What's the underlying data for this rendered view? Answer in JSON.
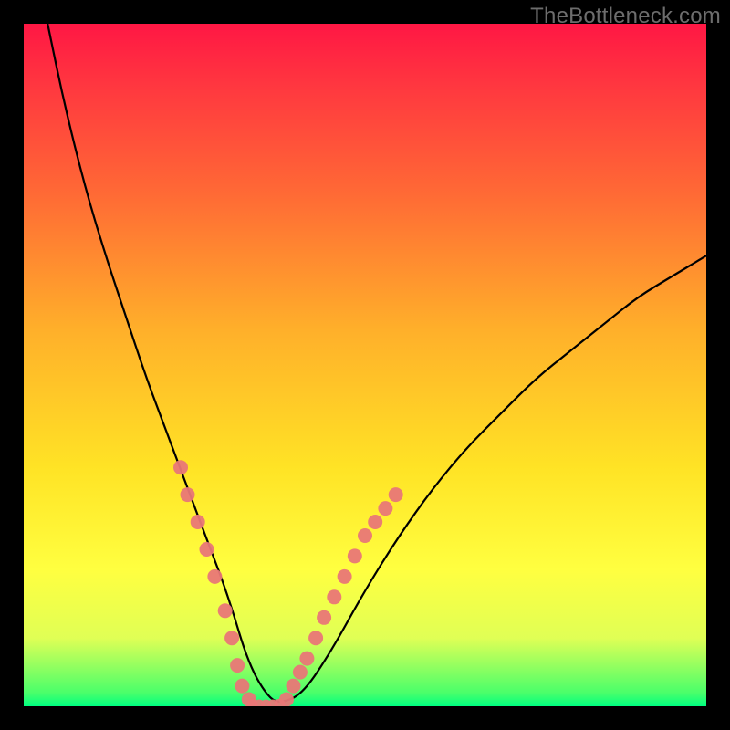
{
  "watermark": "TheBottleneck.com",
  "colors": {
    "background": "#000000",
    "gradient_top": "#ff1744",
    "gradient_bottom": "#00ff80",
    "curve": "#000000",
    "markers": "#e97777"
  },
  "chart_data": {
    "type": "line",
    "title": "",
    "xlabel": "",
    "ylabel": "",
    "xlim": [
      0,
      100
    ],
    "ylim": [
      0,
      100
    ],
    "note": "Bottleneck-style V curve. Minimum region ~x 33–38 at y≈0. Axes and ticks are not labeled; values are estimates.",
    "series": [
      {
        "name": "curve",
        "x": [
          3.5,
          6,
          9,
          12,
          15,
          18,
          21,
          24,
          27,
          30,
          33,
          36,
          38,
          41,
          45,
          50,
          55,
          60,
          65,
          70,
          75,
          80,
          85,
          90,
          95,
          100
        ],
        "y": [
          100,
          88,
          76,
          66,
          57,
          48,
          40,
          32,
          24,
          16,
          6,
          1,
          0.5,
          2,
          8,
          17,
          25,
          32,
          38,
          43,
          48,
          52,
          56,
          60,
          63,
          66
        ]
      }
    ],
    "markers_left": {
      "name": "highlight-left",
      "x": [
        23.0,
        24.0,
        25.5,
        26.8,
        28.0,
        29.5,
        30.5,
        31.3,
        32.0,
        33.0
      ],
      "y": [
        35,
        31,
        27,
        23,
        19,
        14,
        10,
        6,
        3,
        1
      ]
    },
    "markers_right": {
      "name": "highlight-right",
      "x": [
        38.5,
        39.5,
        40.5,
        41.5,
        42.8,
        44.0,
        45.5,
        47.0,
        48.5,
        50.0,
        51.5,
        53.0,
        54.5
      ],
      "y": [
        1,
        3,
        5,
        7,
        10,
        13,
        16,
        19,
        22,
        25,
        27,
        29,
        31
      ]
    },
    "flat_bottom": {
      "name": "flat-bottom-band",
      "x": [
        33.5,
        34.5,
        35.5,
        36.5,
        37.5
      ],
      "y": [
        0.3,
        0.2,
        0.2,
        0.2,
        0.3
      ]
    }
  }
}
